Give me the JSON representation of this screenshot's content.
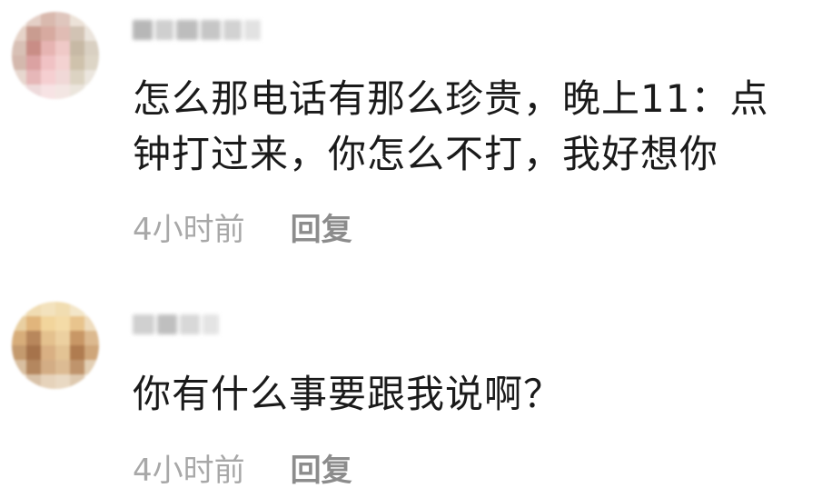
{
  "comments": [
    {
      "text": "怎么那电话有那么珍贵，晚上11：点钟打过来，你怎么不打，我好想你",
      "time": "4小时前",
      "reply_label": "回复",
      "avatar_palette": [
        "#e8d6cf",
        "#dcc4bc",
        "#c9a99c",
        "#e9cfd0",
        "#f0dfe0",
        "#cfc7bd"
      ]
    },
    {
      "text": "你有什么事要跟我说啊？",
      "time": "4小时前",
      "reply_label": "回复",
      "avatar_palette": [
        "#f1dcae",
        "#e7c487",
        "#cfa06b",
        "#b78a5c",
        "#e9d0a7",
        "#a36f4a"
      ]
    }
  ]
}
